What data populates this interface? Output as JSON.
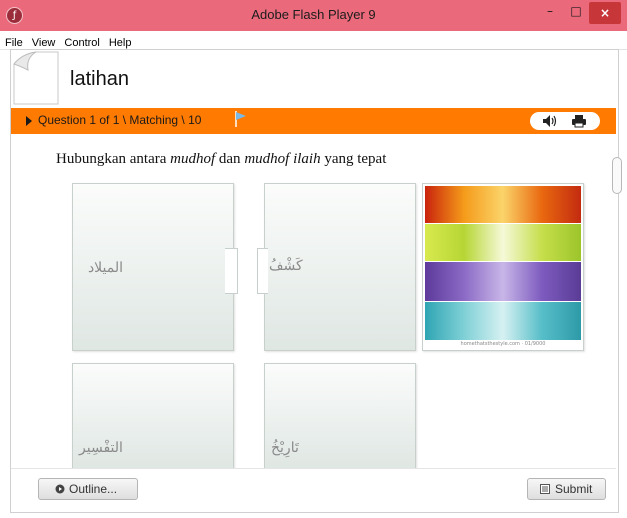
{
  "window": {
    "title": "Adobe Flash Player 9",
    "icon": "flash-icon",
    "controls": {
      "minimize": "–",
      "maximize": "□",
      "close": "×"
    }
  },
  "menu": {
    "items": [
      "File",
      "View",
      "Control",
      "Help"
    ]
  },
  "lesson": {
    "title": "latihan"
  },
  "question_bar": {
    "status": "Question 1 of 1 \\ Matching \\ 10",
    "accent_color": "#ff7a00",
    "tools": [
      "speaker-icon",
      "print-icon"
    ]
  },
  "instruction": {
    "part1": "Hubungkan antara ",
    "term1": "mudhof",
    "part2": " dan ",
    "term2": "mudhof ilaih",
    "part3": " yang tepat"
  },
  "cards": {
    "left_top": "الميلاد",
    "middle_top": "كَشْفُ",
    "left_bottom": "التفْسِير",
    "middle_bottom": "تَارِيْخُ"
  },
  "image_card": {
    "caption": "homethatsthestyle.com · 01/9000"
  },
  "footer": {
    "outline_label": "Outline...",
    "submit_label": "Submit"
  }
}
